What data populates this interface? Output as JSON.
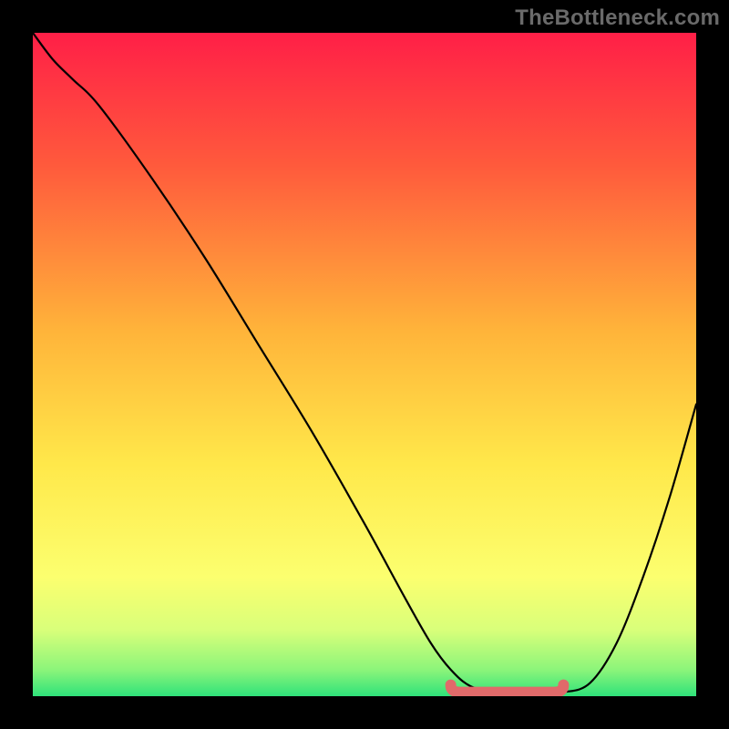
{
  "watermark": "TheBottleneck.com",
  "colors": {
    "page_bg": "#000000",
    "watermark": "#6a6a6a",
    "curve": "#000000",
    "flat_highlight": "#e06a6a",
    "gradient_stops": [
      {
        "offset": "0%",
        "color": "#ff1f47"
      },
      {
        "offset": "20%",
        "color": "#ff5a3c"
      },
      {
        "offset": "45%",
        "color": "#ffb43a"
      },
      {
        "offset": "65%",
        "color": "#ffe84a"
      },
      {
        "offset": "82%",
        "color": "#fcff6f"
      },
      {
        "offset": "90%",
        "color": "#d9ff7a"
      },
      {
        "offset": "96%",
        "color": "#8cf57a"
      },
      {
        "offset": "100%",
        "color": "#2fe27a"
      }
    ]
  },
  "chart_data": {
    "type": "line",
    "title": "",
    "xlabel": "",
    "ylabel": "",
    "xlim": [
      0,
      100
    ],
    "ylim": [
      0,
      100
    ],
    "grid": false,
    "legend": false,
    "series": [
      {
        "name": "curve",
        "x": [
          0,
          3,
          6,
          10,
          18,
          26,
          34,
          42,
          50,
          56,
          60,
          63,
          66,
          70,
          75,
          80,
          84,
          88,
          92,
          96,
          100
        ],
        "y": [
          100,
          96,
          93,
          89,
          78,
          66,
          53,
          40,
          26,
          15,
          8,
          4,
          1.5,
          0.6,
          0.4,
          0.6,
          2,
          8,
          18,
          30,
          44
        ]
      }
    ],
    "annotations": {
      "flat_region": {
        "x_start": 63,
        "x_end": 80,
        "y": 0.6
      }
    }
  }
}
